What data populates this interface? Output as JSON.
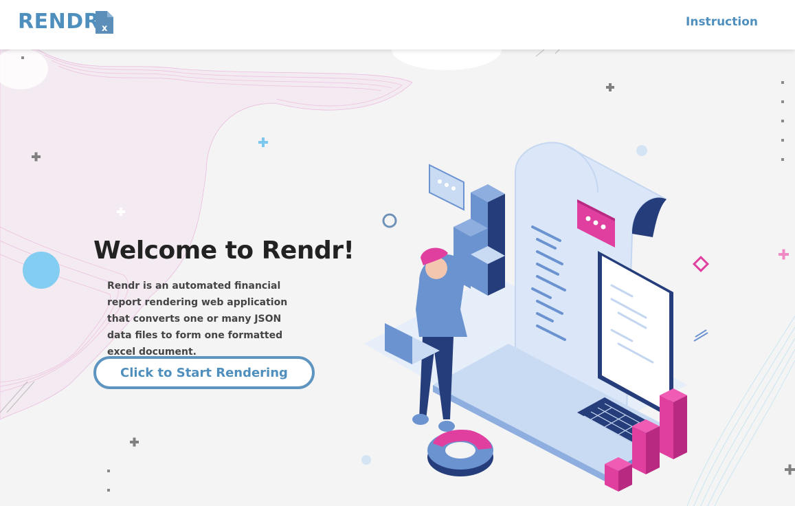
{
  "header": {
    "brand": "RENDR",
    "brand_icon": "excel-file-icon",
    "nav_instruction": "Instruction"
  },
  "hero": {
    "title": "Welcome to Rendr!",
    "description": "Rendr is an automated financial report rendering web application that converts one or many JSON data files to form one formatted excel document.",
    "cta_label": "Click to Start Rendering"
  },
  "colors": {
    "accent": "#4f8fbd",
    "pink": "#e03fa0",
    "navy": "#253d7a",
    "blue": "#6b93d0"
  }
}
